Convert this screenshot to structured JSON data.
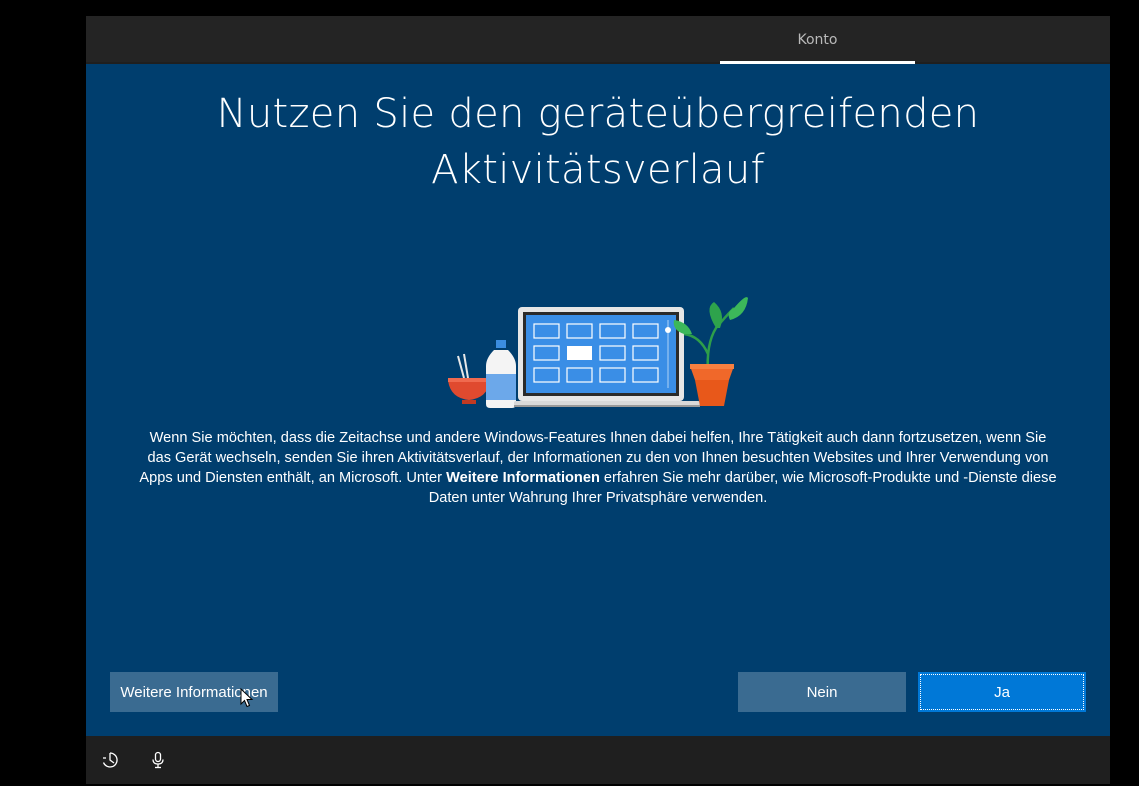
{
  "header": {
    "tabs": [
      {
        "label": "Konto",
        "active": true
      }
    ]
  },
  "main": {
    "title_line1": "Nutzen Sie den geräteübergreifenden",
    "title_line2": "Aktivitätsverlauf",
    "description_before": "Wenn Sie möchten, dass die Zeitachse und andere Windows-Features Ihnen dabei helfen, Ihre Tätigkeit auch dann fortzusetzen, wenn Sie das Gerät wechseln, senden Sie ihren Aktivitätsverlauf, der Informationen zu den von Ihnen besuchten Websites und Ihrer Verwendung von Apps und Diensten enthält, an Microsoft. Unter ",
    "description_bold": "Weitere Informationen",
    "description_after": " erfahren Sie mehr darüber, wie Microsoft-Produkte und -Dienste diese Daten unter Wahrung Ihrer Privatsphäre verwenden."
  },
  "buttons": {
    "more_info": "Weitere Informationen",
    "no": "Nein",
    "yes": "Ja"
  },
  "footer": {
    "icons": [
      "accessibility-icon",
      "microphone-icon"
    ]
  },
  "colors": {
    "background": "#003e6e",
    "primary_button": "#0078d7",
    "secondary_button": "#3a6b91",
    "bar": "#1f1f1f"
  }
}
